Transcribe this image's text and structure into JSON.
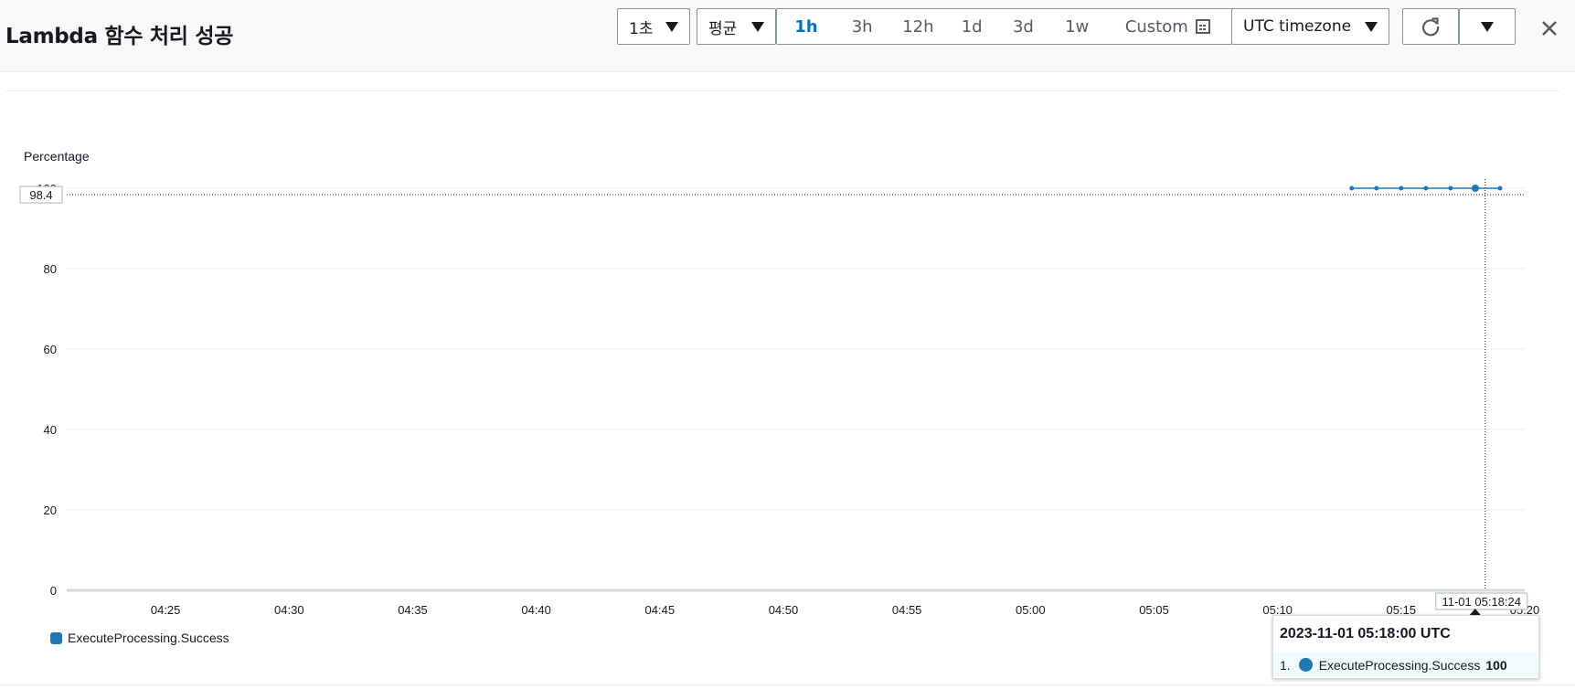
{
  "header": {
    "title": "Lambda 함수 처리 성공",
    "period": "1초",
    "statistic": "평균",
    "ranges": [
      "1h",
      "3h",
      "12h",
      "1d",
      "3d",
      "1w"
    ],
    "active_range": "1h",
    "custom_label": "Custom",
    "timezone": "UTC timezone"
  },
  "chart_data": {
    "type": "line",
    "ylabel": "Percentage",
    "ylim": [
      0,
      100
    ],
    "y_ticks": [
      0,
      20,
      40,
      60,
      80,
      100
    ],
    "x_ticks": [
      "04:25",
      "04:30",
      "04:35",
      "04:40",
      "04:45",
      "04:50",
      "04:55",
      "05:00",
      "05:05",
      "05:10",
      "05:15",
      "05:20"
    ],
    "x_range_minutes": [
      "04:21",
      "05:20"
    ],
    "series": [
      {
        "name": "ExecuteProcessing.Success",
        "color": "#1f77b4",
        "x": [
          "05:13",
          "05:14",
          "05:15",
          "05:16",
          "05:17",
          "05:18",
          "05:19"
        ],
        "values": [
          100,
          100,
          100,
          100,
          100,
          100,
          100
        ]
      }
    ],
    "crosshair": {
      "y_value_label": "98.4",
      "x_value_label": "11-01 05:18:24",
      "y": 98.4,
      "x": "05:18:24"
    }
  },
  "tooltip": {
    "timestamp": "2023-11-01 05:18:00 UTC",
    "index": "1.",
    "series": "ExecuteProcessing.Success",
    "value": "100"
  }
}
